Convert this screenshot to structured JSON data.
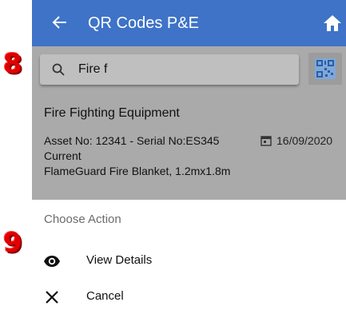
{
  "annotations": {
    "step_a": "8",
    "step_b": "9"
  },
  "appbar": {
    "title": "QR Codes P&E",
    "color": "#3e73c7",
    "back_icon": "arrow-left-icon",
    "home_icon": "home-icon"
  },
  "search": {
    "value": "Fire f",
    "icon": "search-icon",
    "qr_icon": "qr-code-icon"
  },
  "item": {
    "title": "Fire Fighting Equipment",
    "asset_line": "Asset No: 12341 - Serial No:ES345",
    "status": "Current",
    "description": "FlameGuard Fire Blanket, 1.2mx1.8m",
    "date": "16/09/2020"
  },
  "sheet": {
    "title": "Choose Action",
    "actions": [
      {
        "label": "View Details",
        "icon": "eye-icon"
      },
      {
        "label": "Cancel",
        "icon": "close-icon"
      }
    ]
  }
}
